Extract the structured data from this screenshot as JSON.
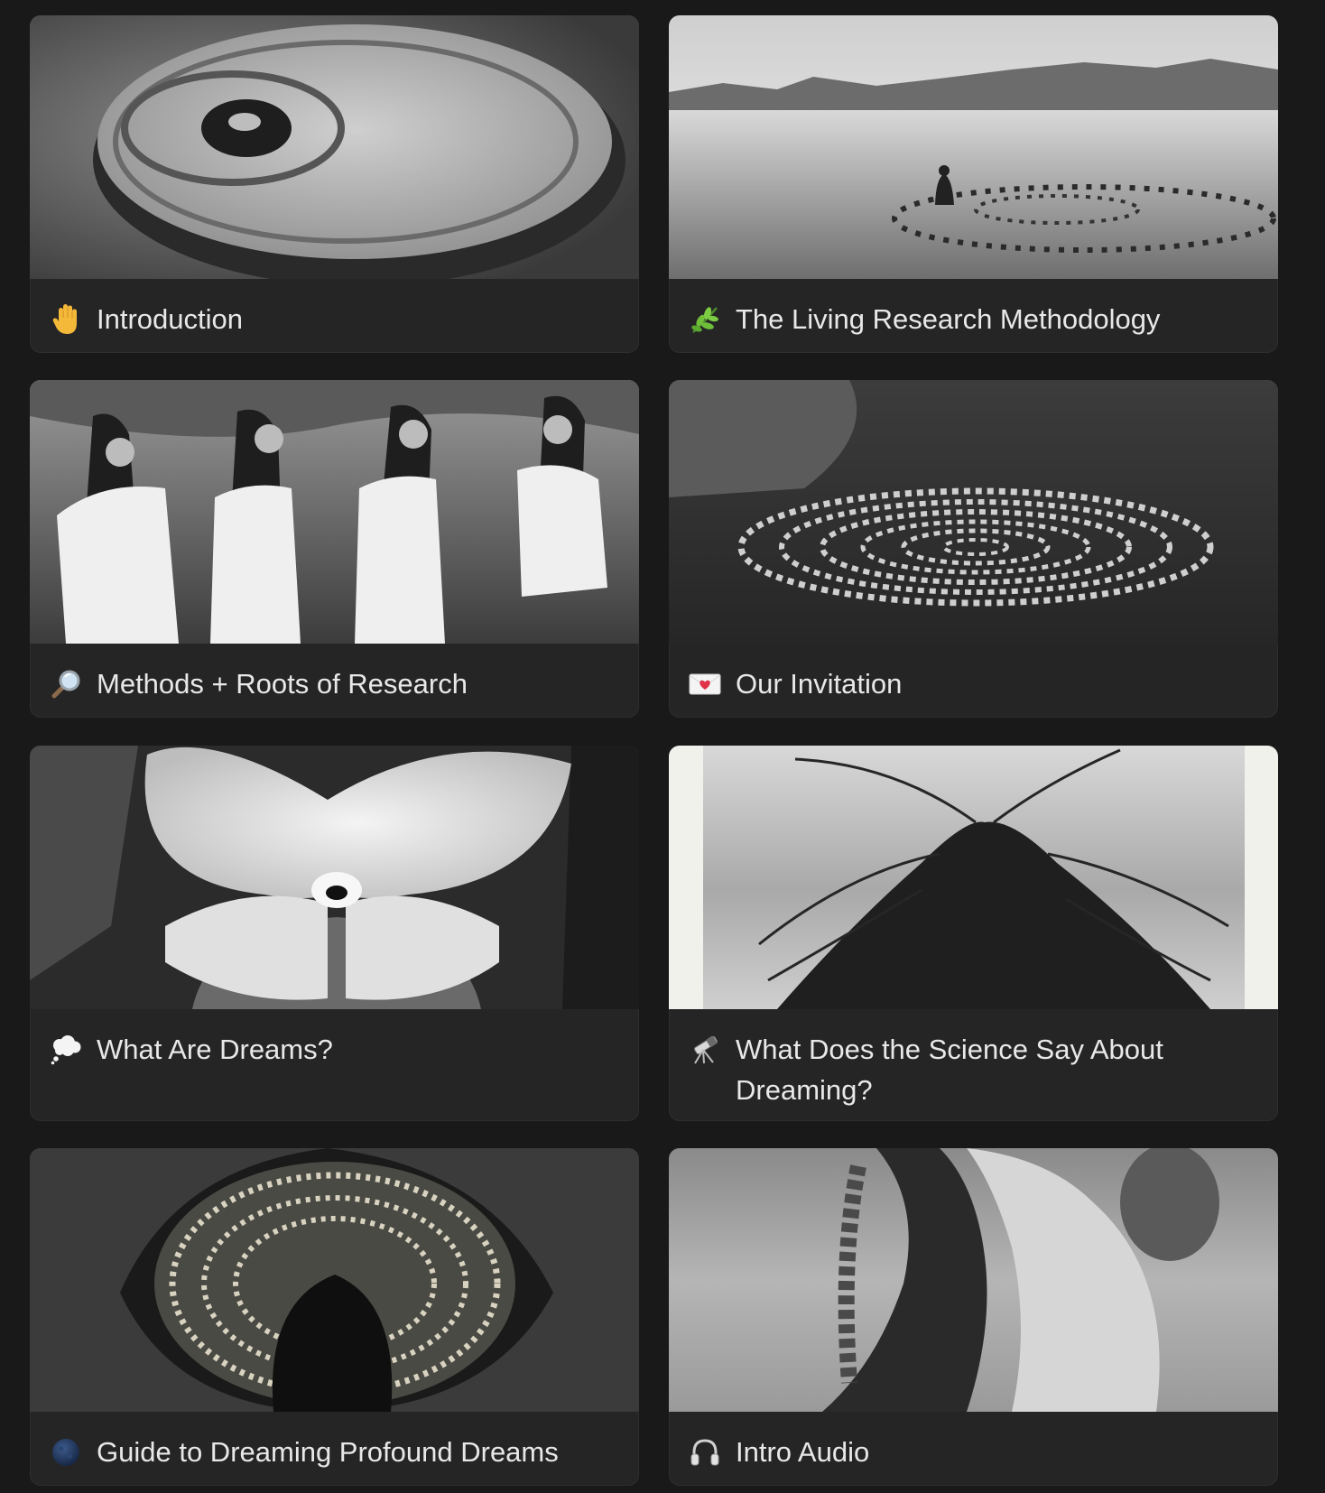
{
  "cards": [
    {
      "title": "Introduction",
      "icon": "raised-hand-icon",
      "cover": "spiral-earthwork-photo"
    },
    {
      "title": "The Living Research Methodology",
      "icon": "herb-icon",
      "cover": "stone-spiral-landscape-photo"
    },
    {
      "title": "Methods + Roots of Research",
      "icon": "magnifying-glass-icon",
      "cover": "women-braiding-hair-photo"
    },
    {
      "title": "Our Invitation",
      "icon": "love-letter-icon",
      "cover": "stone-labyrinth-photo"
    },
    {
      "title": "What Are Dreams?",
      "icon": "thought-balloon-icon",
      "cover": "orchid-face-photo"
    },
    {
      "title": "What Does the Science Say About Dreaming?",
      "icon": "telescope-icon",
      "cover": "roots-on-beach-photo"
    },
    {
      "title": "Guide to Dreaming Profound Dreams",
      "icon": "new-moon-icon",
      "cover": "shell-spiral-photo"
    },
    {
      "title": "Intro Audio",
      "icon": "headphones-icon",
      "cover": "braid-figure-photo"
    }
  ],
  "colors": {
    "page_background": "#191919",
    "card_background": "#252525",
    "text": "#e8e8e8"
  }
}
